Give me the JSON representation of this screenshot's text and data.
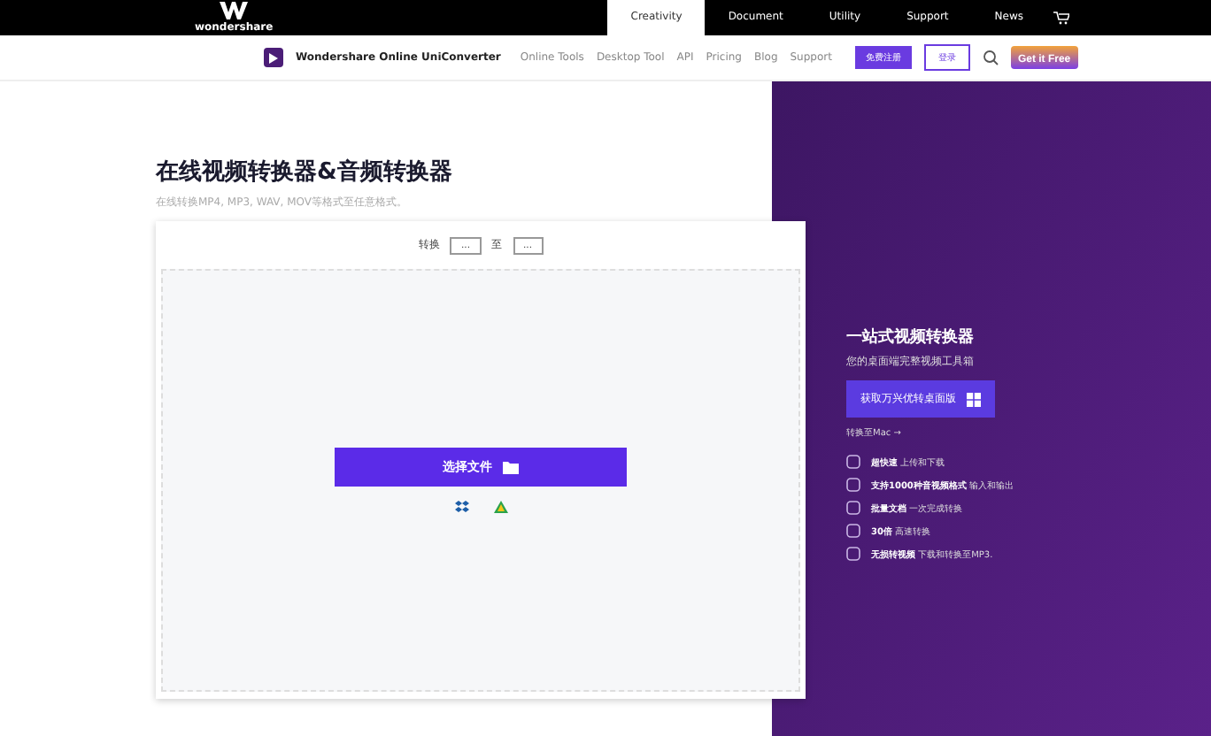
{
  "top_bar": {
    "brand": "wondershare",
    "tabs": [
      {
        "label": "Creativity",
        "selected": true
      },
      {
        "label": "Document",
        "selected": false
      },
      {
        "label": "Utility",
        "selected": false
      },
      {
        "label": "Support",
        "selected": false
      },
      {
        "label": "News",
        "selected": false
      }
    ]
  },
  "nav": {
    "product": "Wondershare Online UniConverter",
    "links": [
      "Online Tools",
      "Desktop Tool",
      "API",
      "Pricing",
      "Blog",
      "Support"
    ],
    "signup": "免费注册",
    "login": "登录",
    "promo": "Get it Free"
  },
  "hero": {
    "title": "在线视频转换器&音频转换器",
    "subtitle": "在线转换MP4, MP3, WAV, MOV等格式至任意格式。"
  },
  "converter": {
    "from_label": "转换",
    "from_value": "...",
    "to_label": "至",
    "to_value": "...",
    "upload_button": "选择文件"
  },
  "side_panel": {
    "title": "一站式视频转换器",
    "subtitle": "您的桌面端完整视频工具箱",
    "download_button": "获取万兴优转桌面版",
    "mac_link": "转换至Mac →",
    "features": [
      {
        "bold": "超快速",
        "text": "上传和下载"
      },
      {
        "bold": "支持1000种音视频格式",
        "text": "输入和输出"
      },
      {
        "bold": "批量文档",
        "text": "一次完成转换"
      },
      {
        "bold": "30倍",
        "text": "高速转换"
      },
      {
        "bold": "无损转视频",
        "text": "下载和转换至MP3."
      }
    ]
  }
}
